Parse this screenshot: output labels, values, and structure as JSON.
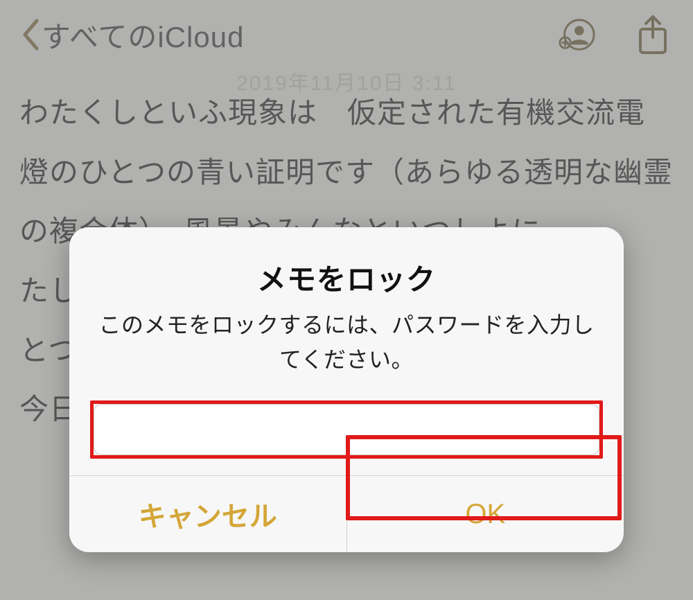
{
  "header": {
    "back_label": "すべてのiCloud",
    "date_text": "2019年11月10日 3:11"
  },
  "note": {
    "body_lines": [
      "わたくしといふ現象は　仮定された有機交流電燈のひとつの青い証明です（あらゆる透明な幽霊の複合体）。風景やみんなといつしよに",
      "たし",
      "とつ",
      "今日"
    ]
  },
  "dialog": {
    "title": "メモをロック",
    "message": "このメモをロックするには、パスワードを入力してください。",
    "password_value": "",
    "cancel_label": "キャンセル",
    "ok_label": "OK"
  },
  "icons": {
    "back": "chevron-left-icon",
    "add_person": "add-person-icon",
    "share": "share-icon"
  },
  "colors": {
    "accent": "#d4a637",
    "highlight": "#e11a1a"
  }
}
